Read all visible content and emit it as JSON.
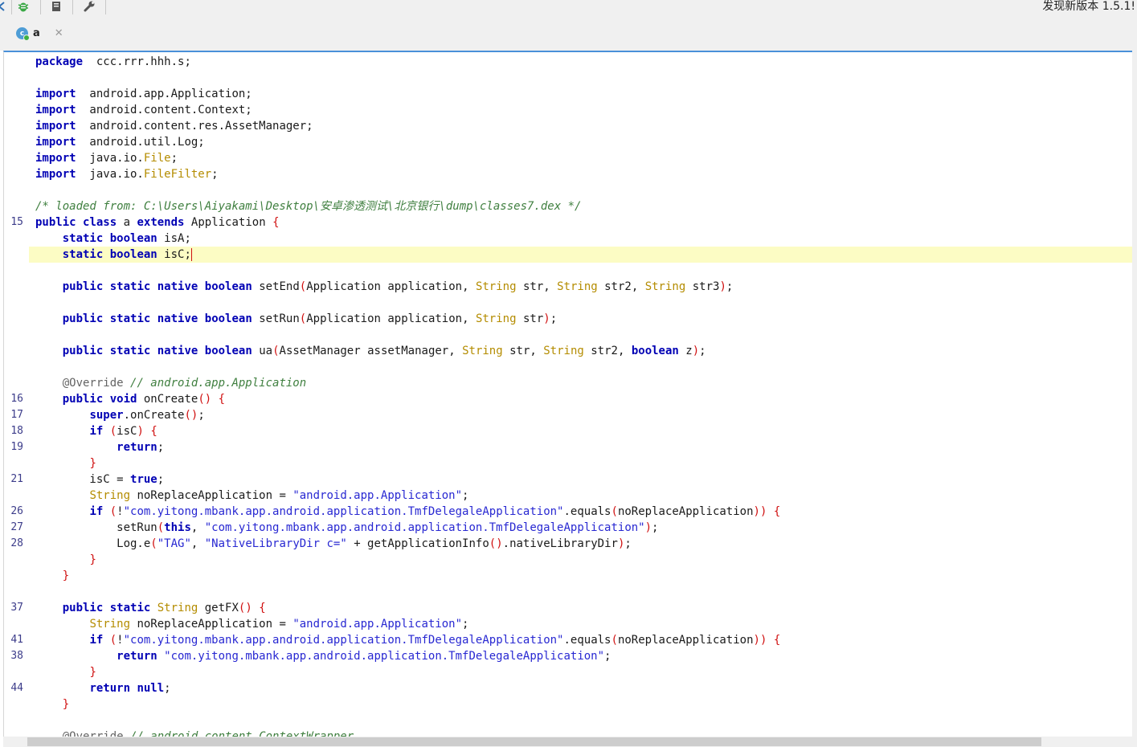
{
  "toolbar": {
    "update_notice": "发现新版本 1.5.1!",
    "icons": [
      "arrow-icon",
      "bug-icon",
      "document-icon",
      "wrench-icon"
    ]
  },
  "tab": {
    "label": "a",
    "icon_letter": "c"
  },
  "editor": {
    "caret_line": 13,
    "lines": [
      {
        "ln": "",
        "tokens": [
          [
            "kw",
            "package"
          ],
          [
            "",
            "  ccc.rrr.hhh.s;"
          ]
        ]
      },
      {
        "ln": "",
        "tokens": []
      },
      {
        "ln": "",
        "tokens": [
          [
            "kw",
            "import"
          ],
          [
            "",
            "  android.app.Application;"
          ]
        ]
      },
      {
        "ln": "",
        "tokens": [
          [
            "kw",
            "import"
          ],
          [
            "",
            "  android.content.Context;"
          ]
        ]
      },
      {
        "ln": "",
        "tokens": [
          [
            "kw",
            "import"
          ],
          [
            "",
            "  android.content.res.AssetManager;"
          ]
        ]
      },
      {
        "ln": "",
        "tokens": [
          [
            "kw",
            "import"
          ],
          [
            "",
            "  android.util.Log;"
          ]
        ]
      },
      {
        "ln": "",
        "tokens": [
          [
            "kw",
            "import"
          ],
          [
            "",
            "  java.io."
          ],
          [
            "ty",
            "File"
          ],
          [
            "",
            ";"
          ]
        ]
      },
      {
        "ln": "",
        "tokens": [
          [
            "kw",
            "import"
          ],
          [
            "",
            "  java.io."
          ],
          [
            "ty",
            "FileFilter"
          ],
          [
            "",
            ";"
          ]
        ]
      },
      {
        "ln": "",
        "tokens": []
      },
      {
        "ln": "",
        "tokens": [
          [
            "cm",
            "/* loaded from: C:\\Users\\Aiyakami\\Desktop\\安卓渗透测试\\北京银行\\dump\\classes7.dex */"
          ]
        ]
      },
      {
        "ln": "15",
        "tokens": [
          [
            "kw",
            "public"
          ],
          [
            "",
            " "
          ],
          [
            "kw",
            "class"
          ],
          [
            "",
            " a "
          ],
          [
            "kw",
            "extends"
          ],
          [
            "",
            " Application "
          ],
          [
            "br",
            "{"
          ]
        ]
      },
      {
        "ln": "",
        "tokens": [
          [
            "",
            "    "
          ],
          [
            "kw",
            "static"
          ],
          [
            "",
            " "
          ],
          [
            "kw",
            "boolean"
          ],
          [
            "",
            " isA;"
          ]
        ]
      },
      {
        "ln": "",
        "tokens": [
          [
            "",
            "    "
          ],
          [
            "kw",
            "static"
          ],
          [
            "",
            " "
          ],
          [
            "kw",
            "boolean"
          ],
          [
            "",
            " isC;"
          ]
        ]
      },
      {
        "ln": "",
        "tokens": []
      },
      {
        "ln": "",
        "tokens": [
          [
            "",
            "    "
          ],
          [
            "kw",
            "public"
          ],
          [
            "",
            " "
          ],
          [
            "kw",
            "static"
          ],
          [
            "",
            " "
          ],
          [
            "kw",
            "native"
          ],
          [
            "",
            " "
          ],
          [
            "kw",
            "boolean"
          ],
          [
            "",
            " setEnd"
          ],
          [
            "br",
            "("
          ],
          [
            "",
            "Application application, "
          ],
          [
            "ty",
            "String"
          ],
          [
            "",
            " str, "
          ],
          [
            "ty",
            "String"
          ],
          [
            "",
            " str2, "
          ],
          [
            "ty",
            "String"
          ],
          [
            "",
            " str3"
          ],
          [
            "br",
            ")"
          ],
          [
            "",
            ";"
          ]
        ]
      },
      {
        "ln": "",
        "tokens": []
      },
      {
        "ln": "",
        "tokens": [
          [
            "",
            "    "
          ],
          [
            "kw",
            "public"
          ],
          [
            "",
            " "
          ],
          [
            "kw",
            "static"
          ],
          [
            "",
            " "
          ],
          [
            "kw",
            "native"
          ],
          [
            "",
            " "
          ],
          [
            "kw",
            "boolean"
          ],
          [
            "",
            " setRun"
          ],
          [
            "br",
            "("
          ],
          [
            "",
            "Application application, "
          ],
          [
            "ty",
            "String"
          ],
          [
            "",
            " str"
          ],
          [
            "br",
            ")"
          ],
          [
            "",
            ";"
          ]
        ]
      },
      {
        "ln": "",
        "tokens": []
      },
      {
        "ln": "",
        "tokens": [
          [
            "",
            "    "
          ],
          [
            "kw",
            "public"
          ],
          [
            "",
            " "
          ],
          [
            "kw",
            "static"
          ],
          [
            "",
            " "
          ],
          [
            "kw",
            "native"
          ],
          [
            "",
            " "
          ],
          [
            "kw",
            "boolean"
          ],
          [
            "",
            " ua"
          ],
          [
            "br",
            "("
          ],
          [
            "",
            "AssetManager assetManager, "
          ],
          [
            "ty",
            "String"
          ],
          [
            "",
            " str, "
          ],
          [
            "ty",
            "String"
          ],
          [
            "",
            " str2, "
          ],
          [
            "kw",
            "boolean"
          ],
          [
            "",
            " z"
          ],
          [
            "br",
            ")"
          ],
          [
            "",
            ";"
          ]
        ]
      },
      {
        "ln": "",
        "tokens": []
      },
      {
        "ln": "",
        "tokens": [
          [
            "",
            "    "
          ],
          [
            "an",
            "@Override"
          ],
          [
            "",
            " "
          ],
          [
            "cm",
            "// android.app.Application"
          ]
        ]
      },
      {
        "ln": "16",
        "tokens": [
          [
            "",
            "    "
          ],
          [
            "kw",
            "public"
          ],
          [
            "",
            " "
          ],
          [
            "kw",
            "void"
          ],
          [
            "",
            " onCreate"
          ],
          [
            "br",
            "()"
          ],
          [
            "",
            " "
          ],
          [
            "br",
            "{"
          ]
        ]
      },
      {
        "ln": "17",
        "tokens": [
          [
            "",
            "        "
          ],
          [
            "kw",
            "super"
          ],
          [
            "",
            ".onCreate"
          ],
          [
            "br",
            "()"
          ],
          [
            "",
            ";"
          ]
        ]
      },
      {
        "ln": "18",
        "tokens": [
          [
            "",
            "        "
          ],
          [
            "kw",
            "if"
          ],
          [
            "",
            " "
          ],
          [
            "br",
            "("
          ],
          [
            "",
            "isC"
          ],
          [
            "br",
            ")"
          ],
          [
            "",
            " "
          ],
          [
            "br",
            "{"
          ]
        ]
      },
      {
        "ln": "19",
        "tokens": [
          [
            "",
            "            "
          ],
          [
            "kw",
            "return"
          ],
          [
            "",
            ";"
          ]
        ]
      },
      {
        "ln": "",
        "tokens": [
          [
            "",
            "        "
          ],
          [
            "br",
            "}"
          ]
        ]
      },
      {
        "ln": "21",
        "tokens": [
          [
            "",
            "        isC = "
          ],
          [
            "kw",
            "true"
          ],
          [
            "",
            ";"
          ]
        ]
      },
      {
        "ln": "",
        "tokens": [
          [
            "",
            "        "
          ],
          [
            "ty",
            "String"
          ],
          [
            "",
            " noReplaceApplication = "
          ],
          [
            "st",
            "\"android.app.Application\""
          ],
          [
            "",
            ";"
          ]
        ]
      },
      {
        "ln": "26",
        "tokens": [
          [
            "",
            "        "
          ],
          [
            "kw",
            "if"
          ],
          [
            "",
            " "
          ],
          [
            "br",
            "("
          ],
          [
            "",
            "!"
          ],
          [
            "st",
            "\"com.yitong.mbank.app.android.application.TmfDelegaleApplication\""
          ],
          [
            "",
            ".equals"
          ],
          [
            "br",
            "("
          ],
          [
            "",
            "noReplaceApplication"
          ],
          [
            "br",
            "))"
          ],
          [
            "",
            " "
          ],
          [
            "br",
            "{"
          ]
        ]
      },
      {
        "ln": "27",
        "tokens": [
          [
            "",
            "            setRun"
          ],
          [
            "br",
            "("
          ],
          [
            "kw",
            "this"
          ],
          [
            "",
            ", "
          ],
          [
            "st",
            "\"com.yitong.mbank.app.android.application.TmfDelegaleApplication\""
          ],
          [
            "br",
            ")"
          ],
          [
            "",
            ";"
          ]
        ]
      },
      {
        "ln": "28",
        "tokens": [
          [
            "",
            "            Log.e"
          ],
          [
            "br",
            "("
          ],
          [
            "st",
            "\"TAG\""
          ],
          [
            "",
            ", "
          ],
          [
            "st",
            "\"NativeLibraryDir c=\""
          ],
          [
            "",
            " + getApplicationInfo"
          ],
          [
            "br",
            "()"
          ],
          [
            "",
            ".nativeLibraryDir"
          ],
          [
            "br",
            ")"
          ],
          [
            "",
            ";"
          ]
        ]
      },
      {
        "ln": "",
        "tokens": [
          [
            "",
            "        "
          ],
          [
            "br",
            "}"
          ]
        ]
      },
      {
        "ln": "",
        "tokens": [
          [
            "",
            "    "
          ],
          [
            "br",
            "}"
          ]
        ]
      },
      {
        "ln": "",
        "tokens": []
      },
      {
        "ln": "37",
        "tokens": [
          [
            "",
            "    "
          ],
          [
            "kw",
            "public"
          ],
          [
            "",
            " "
          ],
          [
            "kw",
            "static"
          ],
          [
            "",
            " "
          ],
          [
            "ty",
            "String"
          ],
          [
            "",
            " getFX"
          ],
          [
            "br",
            "()"
          ],
          [
            "",
            " "
          ],
          [
            "br",
            "{"
          ]
        ]
      },
      {
        "ln": "",
        "tokens": [
          [
            "",
            "        "
          ],
          [
            "ty",
            "String"
          ],
          [
            "",
            " noReplaceApplication = "
          ],
          [
            "st",
            "\"android.app.Application\""
          ],
          [
            "",
            ";"
          ]
        ]
      },
      {
        "ln": "41",
        "tokens": [
          [
            "",
            "        "
          ],
          [
            "kw",
            "if"
          ],
          [
            "",
            " "
          ],
          [
            "br",
            "("
          ],
          [
            "",
            "!"
          ],
          [
            "st",
            "\"com.yitong.mbank.app.android.application.TmfDelegaleApplication\""
          ],
          [
            "",
            ".equals"
          ],
          [
            "br",
            "("
          ],
          [
            "",
            "noReplaceApplication"
          ],
          [
            "br",
            "))"
          ],
          [
            "",
            " "
          ],
          [
            "br",
            "{"
          ]
        ]
      },
      {
        "ln": "38",
        "tokens": [
          [
            "",
            "            "
          ],
          [
            "kw",
            "return"
          ],
          [
            "",
            " "
          ],
          [
            "st",
            "\"com.yitong.mbank.app.android.application.TmfDelegaleApplication\""
          ],
          [
            "",
            ";"
          ]
        ]
      },
      {
        "ln": "",
        "tokens": [
          [
            "",
            "        "
          ],
          [
            "br",
            "}"
          ]
        ]
      },
      {
        "ln": "44",
        "tokens": [
          [
            "",
            "        "
          ],
          [
            "kw",
            "return"
          ],
          [
            "",
            " "
          ],
          [
            "kw",
            "null"
          ],
          [
            "",
            ";"
          ]
        ]
      },
      {
        "ln": "",
        "tokens": [
          [
            "",
            "    "
          ],
          [
            "br",
            "}"
          ]
        ]
      },
      {
        "ln": "",
        "tokens": []
      },
      {
        "ln": "",
        "tokens": [
          [
            "",
            "    "
          ],
          [
            "an",
            "@Override"
          ],
          [
            "",
            " "
          ],
          [
            "cm",
            "// android.content.ContextWrapper"
          ]
        ]
      }
    ]
  }
}
